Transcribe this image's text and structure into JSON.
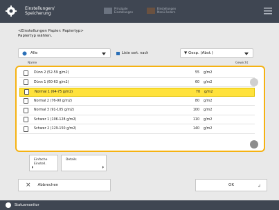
{
  "header": {
    "title_line1": "Einstellungen/",
    "title_line2": "Speicherung",
    "btn1_line1": "Prinzipale",
    "btn1_line2": "Einstellungen",
    "btn2_line1": "Einstellungen",
    "btn2_line2": "Menü ändern"
  },
  "instruction": {
    "line1": "<Einstellungen Papier: Papiertyp>",
    "line2": "Papiertyp wählen."
  },
  "controls": {
    "filter_value": "Alle",
    "sort_label": "Liste sort. nach",
    "sort_value": "▼ Gesp. (Abst.)"
  },
  "table": {
    "col_name": "Name",
    "col_weight": "Gewicht",
    "rows": [
      {
        "name": "Dünn 2 (52-59 g/m2)",
        "weight": "55",
        "unit": "g/m2"
      },
      {
        "name": "Dünn 1 (60-63 g/m2)",
        "weight": "60",
        "unit": "g/m2"
      },
      {
        "name": "Normal 1 (64-75 g/m2)",
        "weight": "70",
        "unit": "g/m2"
      },
      {
        "name": "Normal 2 (76-90 g/m2)",
        "weight": "80",
        "unit": "g/m2"
      },
      {
        "name": "Normal 3 (91-105 g/m2)",
        "weight": "100",
        "unit": "g/m2"
      },
      {
        "name": "Schwer 1 (106-128 g/m2)",
        "weight": "110",
        "unit": "g/m2"
      },
      {
        "name": "Schwer 2 (129-150 g/m2)",
        "weight": "140",
        "unit": "g/m2"
      }
    ]
  },
  "buttons": {
    "simple_line1": "Einfache",
    "simple_line2": "Einstell.",
    "details": "Details",
    "cancel": "Abbrechen",
    "ok": "OK"
  },
  "footer": {
    "status": "Statusmonitor"
  },
  "colors": {
    "header_bg": "#3f4652",
    "highlight": "#ffe23c",
    "border_accent": "#f5b212"
  },
  "icons": {
    "settings": "gear-icon",
    "menu": "hamburger-icon",
    "close": "close-icon",
    "status": "status-monitor-icon"
  }
}
